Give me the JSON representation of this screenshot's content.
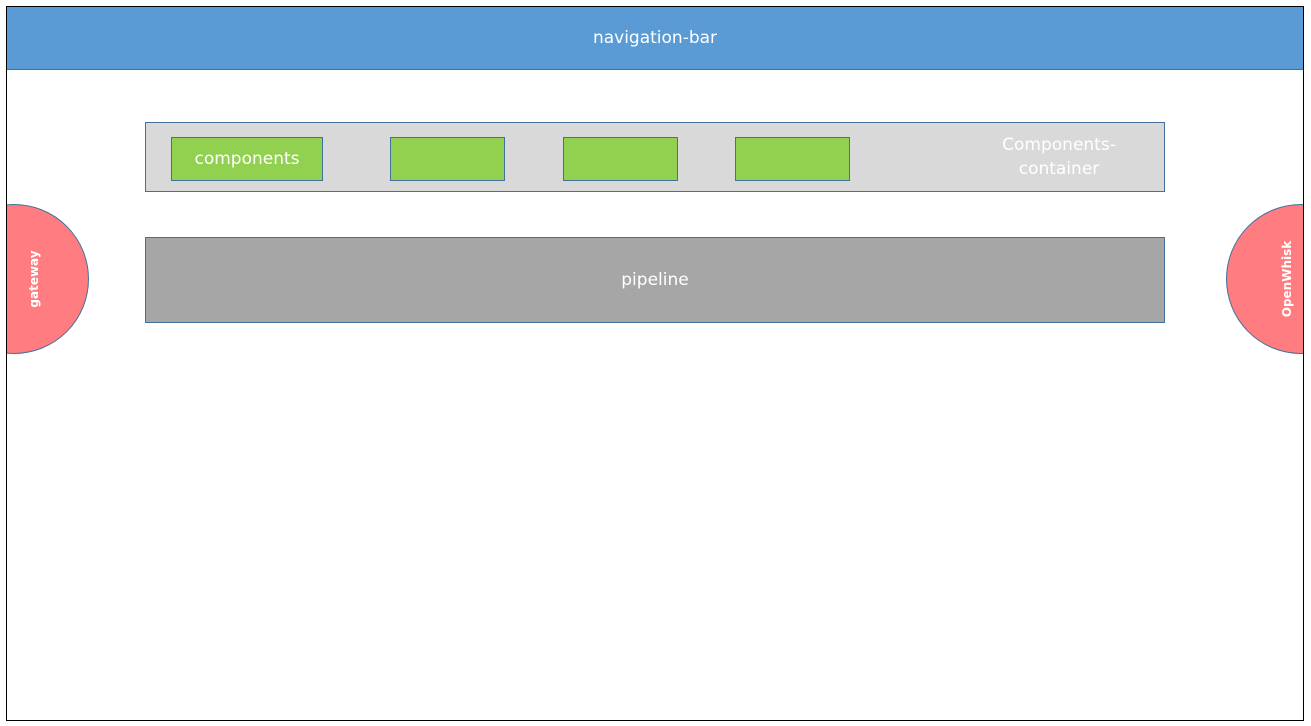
{
  "navigation_bar": {
    "label": "navigation-bar"
  },
  "components_container": {
    "label": "Components-\ncontainer",
    "components": [
      {
        "label": "components"
      },
      {
        "label": ""
      },
      {
        "label": ""
      },
      {
        "label": ""
      }
    ]
  },
  "pipeline": {
    "label": "pipeline"
  },
  "gateway": {
    "label": "gateway"
  },
  "openwhisk": {
    "label": "OpenWhisk"
  },
  "colors": {
    "navigation_bar": "#5b9bd5",
    "components_container": "#d9d9d9",
    "component": "#92d050",
    "pipeline": "#a6a6a6",
    "side_nodes": "#ff7c80",
    "borders": "#41719c"
  }
}
